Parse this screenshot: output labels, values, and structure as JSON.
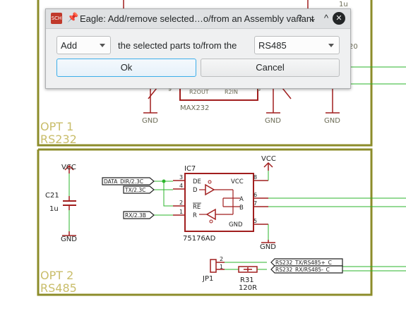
{
  "schematic": {
    "upper_sheet": {
      "label_line1": "OPT 1",
      "label_line2": "RS232",
      "pin_r2out": "R2OUT",
      "pin_r2in": "R2IN",
      "part_name": "MAX232",
      "pin_num_9": "9",
      "pin_num_8": "8",
      "gnd1": "GND",
      "gnd2": "GND",
      "gnd3": "GND",
      "partial_value": "1u",
      "partial_20": "20"
    },
    "lower_sheet": {
      "label_line1": "OPT 2",
      "label_line2": "RS485",
      "ic_name": "IC7",
      "ic_value": "75176AD",
      "pin_de": "DE",
      "pin_d": "D",
      "pin_re": "RE",
      "pin_r": "R",
      "pin_vcc": "VCC",
      "pin_a": "A",
      "pin_b": "B",
      "pin_gnd": "GND",
      "pn_3": "3",
      "pn_4": "4",
      "pn_2": "2",
      "pn_1": "1",
      "pn_8": "8",
      "pn_6": "6",
      "pn_7": "7",
      "pn_5": "5",
      "vcc_left": "VCC",
      "vcc_right": "VCC",
      "cap_name": "C21",
      "cap_value": "1u",
      "gnd_left": "GND",
      "gnd_right": "GND",
      "net_data_dir": "DATA_DIR/2.3C",
      "net_tx": "TX/2.3C",
      "net_rx": "RX/2.3B",
      "net_rs232_tx": "RS232_TX/RS485+_C",
      "net_rs232_rx": "RS232_RX/RS485-_C",
      "jp_name": "JP1",
      "jp_pin2": "2",
      "jp_pin1": "1",
      "res_name": "R31",
      "res_value": "120R"
    }
  },
  "dialog": {
    "app_icon_text": "SCH",
    "title": "Eagle: Add/remove selected…o/from an Assembly variant",
    "help_glyph": "?",
    "collapse_glyph": "⌄",
    "maximize_glyph": "^",
    "close_glyph": "✕",
    "action_value": "Add",
    "middle_text": "the selected parts to/from the",
    "variant_value": "RS485",
    "ok_label": "Ok",
    "cancel_label": "Cancel"
  },
  "colors": {
    "frame": "#8c8c2a",
    "part_outline": "#a11e1e",
    "net_wire": "#2bb52b",
    "sheet_label": "#c9bd6a",
    "accent": "#3daee9"
  }
}
